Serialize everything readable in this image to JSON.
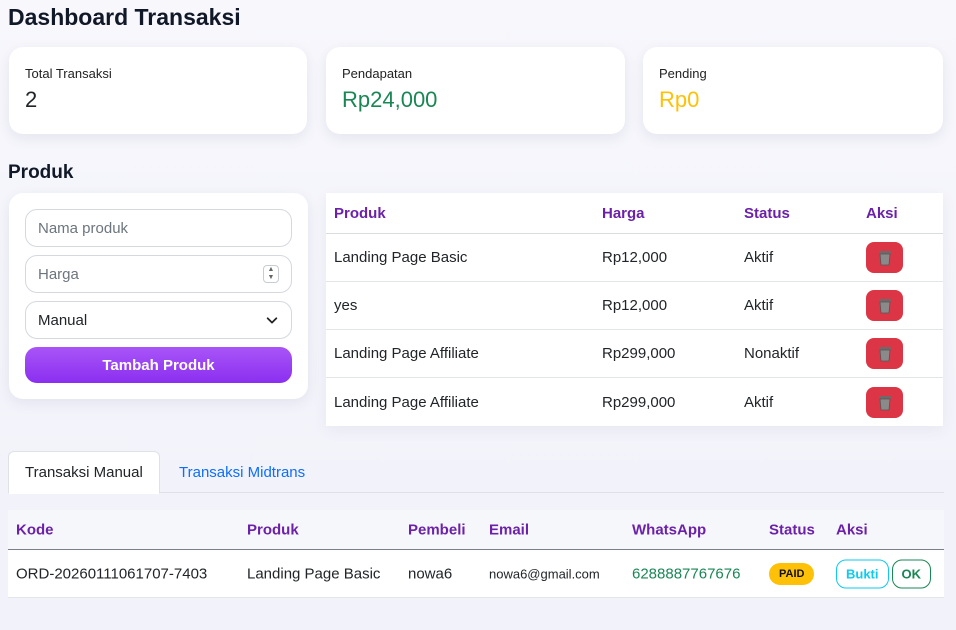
{
  "page": {
    "title": "Dashboard Transaksi"
  },
  "stats": [
    {
      "label": "Total Transaksi",
      "value": "2",
      "color": "#212529"
    },
    {
      "label": "Pendapatan",
      "value": "Rp24,000",
      "color": "#198754"
    },
    {
      "label": "Pending",
      "value": "Rp0",
      "color": "#ffc107"
    }
  ],
  "produk_section": {
    "title": "Produk"
  },
  "form": {
    "name_placeholder": "Nama produk",
    "price_placeholder": "Harga",
    "type_selected": "Manual",
    "submit_label": "Tambah Produk"
  },
  "product_table": {
    "headers": [
      "Produk",
      "Harga",
      "Status",
      "Aksi"
    ],
    "rows": [
      {
        "produk": "Landing Page Basic",
        "harga": "Rp12,000",
        "status": "Aktif"
      },
      {
        "produk": "yes",
        "harga": "Rp12,000",
        "status": "Aktif"
      },
      {
        "produk": "Landing Page Affiliate",
        "harga": "Rp299,000",
        "status": "Nonaktif"
      },
      {
        "produk": "Landing Page Affiliate",
        "harga": "Rp299,000",
        "status": "Aktif"
      }
    ],
    "delete_icon": "trash-icon",
    "delete_color": "#dc3545"
  },
  "tabs": [
    {
      "label": "Transaksi Manual",
      "active": true
    },
    {
      "label": "Transaksi Midtrans",
      "active": false
    }
  ],
  "trx_table": {
    "headers": [
      "Kode",
      "Produk",
      "Pembeli",
      "Email",
      "WhatsApp",
      "Status",
      "Aksi"
    ],
    "rows": [
      {
        "kode": "ORD-20260111061707-7403",
        "produk": "Landing Page Basic",
        "pembeli": "nowa6",
        "email": "nowa6@gmail.com",
        "whatsapp": "6288887767676",
        "status": "PAID",
        "bukti_label": "Bukti",
        "ok_label": "OK"
      }
    ]
  },
  "colors": {
    "accent": "#6b21a8",
    "button": "#9333ea",
    "whatsapp": "#198754"
  }
}
